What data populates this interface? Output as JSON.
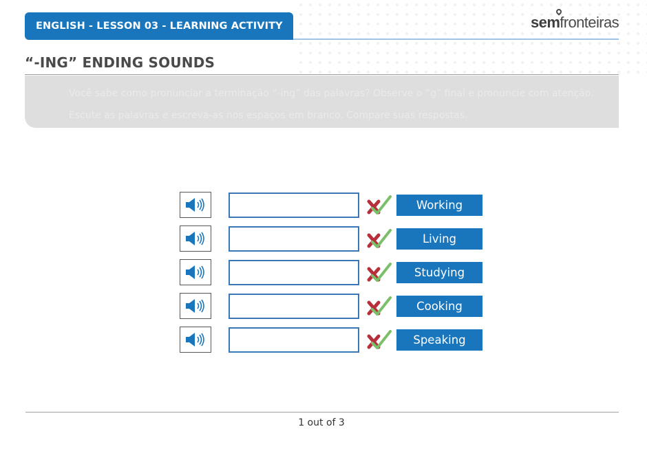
{
  "header": {
    "title": "ENGLISH - LESSON 03 - LEARNING ACTIVITY",
    "logo_part1": "sem",
    "logo_part2": "fronteiras"
  },
  "page_title": "“-ING” ENDING SOUNDS",
  "instructions": [
    "Você sabe como pronunciar a terminação “-ing” das palavras? Observe o “g” final e pronuncie com atenção.",
    "Escute as palavras e escreva-as nos espaços em branco. Compare suas respostas."
  ],
  "rows": [
    {
      "word": "Working",
      "input_value": "",
      "audio_icon": "speaker-icon"
    },
    {
      "word": "Living",
      "input_value": "",
      "audio_icon": "speaker-icon"
    },
    {
      "word": "Studying",
      "input_value": "",
      "audio_icon": "speaker-icon"
    },
    {
      "word": "Cooking",
      "input_value": "",
      "audio_icon": "speaker-icon"
    },
    {
      "word": "Speaking",
      "input_value": "",
      "audio_icon": "speaker-icon"
    }
  ],
  "pager": "1 out of 3",
  "colors": {
    "accent": "#1976bd",
    "wrong": "#b5303a",
    "right": "#7bbf6a"
  }
}
